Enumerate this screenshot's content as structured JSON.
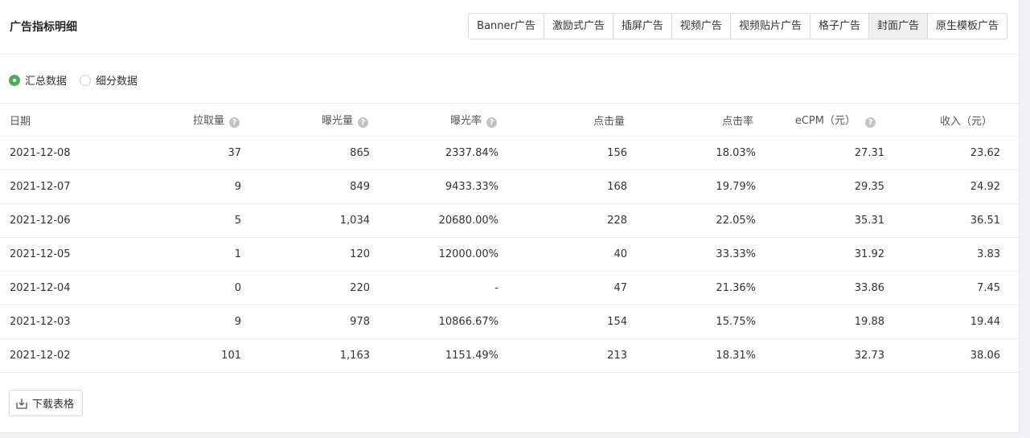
{
  "title": "广告指标明细",
  "tabs": [
    "Banner广告",
    "激励式广告",
    "插屏广告",
    "视频广告",
    "视频贴片广告",
    "格子广告",
    "封面广告",
    "原生模板广告"
  ],
  "active_tab": "封面广告",
  "radios": {
    "summary": "汇总数据",
    "detail": "细分数据",
    "selected": "summary"
  },
  "table": {
    "headers": [
      "日期",
      "拉取量",
      "曝光量",
      "曝光率",
      "点击量",
      "点击率",
      "eCPM（元）",
      "收入（元）"
    ],
    "rows": [
      [
        "2021-12-08",
        "37",
        "865",
        "2337.84%",
        "156",
        "18.03%",
        "27.31",
        "23.62"
      ],
      [
        "2021-12-07",
        "9",
        "849",
        "9433.33%",
        "168",
        "19.79%",
        "29.35",
        "24.92"
      ],
      [
        "2021-12-06",
        "5",
        "1,034",
        "20680.00%",
        "228",
        "22.05%",
        "35.31",
        "36.51"
      ],
      [
        "2021-12-05",
        "1",
        "120",
        "12000.00%",
        "40",
        "33.33%",
        "31.92",
        "3.83"
      ],
      [
        "2021-12-04",
        "0",
        "220",
        "-",
        "47",
        "21.36%",
        "33.86",
        "7.45"
      ],
      [
        "2021-12-03",
        "9",
        "978",
        "10866.67%",
        "154",
        "15.75%",
        "19.88",
        "19.44"
      ],
      [
        "2021-12-02",
        "101",
        "1,163",
        "1151.49%",
        "213",
        "18.31%",
        "32.73",
        "38.06"
      ]
    ]
  },
  "help_glyph": "?",
  "download_label": "下载表格",
  "colors": {
    "accent": "#4caf50",
    "active_tab_bg": "#efefef"
  }
}
